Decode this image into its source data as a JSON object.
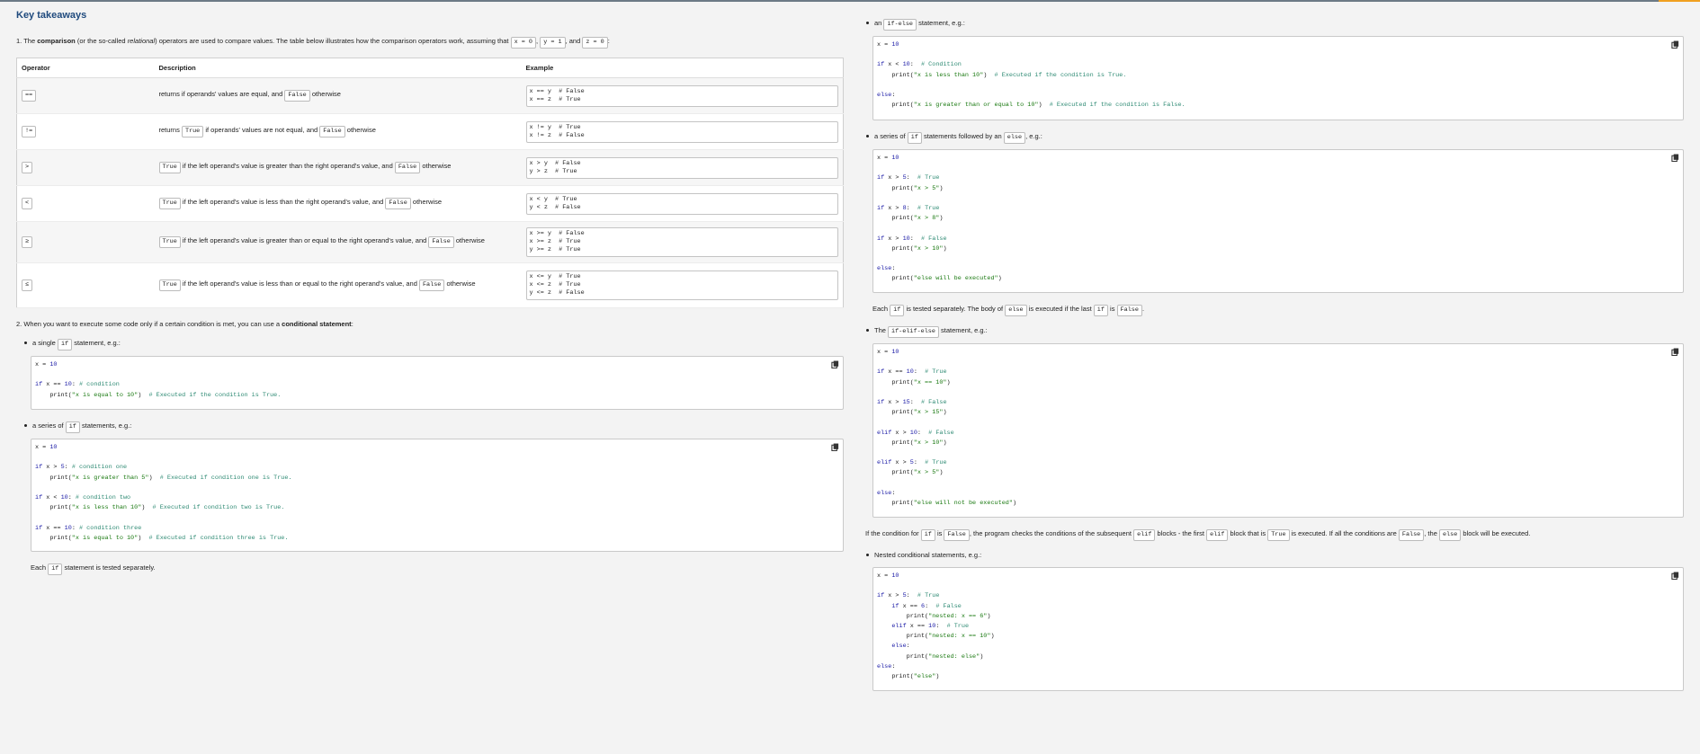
{
  "title": "Key takeaways",
  "intro": {
    "p1": "1. The ",
    "bold": "comparison",
    "p2": " (or the so-called ",
    "italic": "relational",
    "p3": ") operators are used to compare values. The table below illustrates how the comparison operators work, assuming that ",
    "c1": "x = 0",
    "sep1": ", ",
    "c2": "y = 1",
    "sep2": ", and ",
    "c3": "z = 0",
    "end": ":"
  },
  "table": {
    "headers": [
      "Operator",
      "Description",
      "Example"
    ],
    "rows": [
      {
        "op": "==",
        "desc_pre": "returns if operands' values are equal, and ",
        "desc_c1": "False",
        "desc_post": " otherwise",
        "example": [
          "x == y  # False",
          "x == z  # True"
        ]
      },
      {
        "op": "!=",
        "desc_pre": "returns ",
        "desc_c1": "True",
        "desc_mid": " if operands' values are not equal, and ",
        "desc_c2": "False",
        "desc_post": " otherwise",
        "example": [
          "x != y  # True",
          "x != z  # False"
        ]
      },
      {
        "op": ">",
        "desc_c1": "True",
        "desc_mid": " if the left operand's value is greater than the right operand's value, and ",
        "desc_c2": "False",
        "desc_post": " otherwise",
        "example": [
          "x > y  # False",
          "y > z  # True"
        ]
      },
      {
        "op": "<",
        "desc_c1": "True",
        "desc_mid": " if the left operand's value is less than the right operand's value, and ",
        "desc_c2": "False",
        "desc_post": " otherwise",
        "example": [
          "x < y  # True",
          "y < z  # False"
        ]
      },
      {
        "op": "≥",
        "desc_c1": "True",
        "desc_mid": " if the left operand's value is greater than or equal to the right operand's value, and ",
        "desc_c2": "False",
        "desc_post": " otherwise",
        "example": [
          "x >= y  # False",
          "x >= z  # True",
          "y >= z  # True"
        ]
      },
      {
        "op": "≤",
        "desc_c1": "True",
        "desc_mid": " if the left operand's value is less than or equal to the right operand's value, and ",
        "desc_c2": "False",
        "desc_post": " otherwise",
        "example": [
          "x <= y  # True",
          "x <= z  # True",
          "y <= z  # False"
        ]
      }
    ]
  },
  "section2": {
    "pre": "2. When you want to execute some code only if a certain condition is met, you can use a ",
    "bold": "conditional statement",
    "post": ":"
  },
  "b_single": {
    "pre": "a single ",
    "code": "if",
    "post": " statement, e.g.:"
  },
  "b_series": {
    "pre": "a series of ",
    "code": "if",
    "post": " statements, e.g.:"
  },
  "note_series": {
    "pre": "Each ",
    "code": "if",
    "post": " statement is tested separately."
  },
  "b_ifelse": {
    "pre": "an ",
    "code": "if-else",
    "post": " statement, e.g.:"
  },
  "b_series_else": {
    "pre": "a series of ",
    "code": "if",
    "mid": " statements followed by an ",
    "code2": "else",
    "post": ", e.g.:"
  },
  "note_series_else": {
    "pre": "Each ",
    "code1": "if",
    "mid1": " is tested separately. The body of ",
    "code2": "else",
    "mid2": " is executed if the last ",
    "code3": "if",
    "mid3": " is ",
    "code4": "False",
    "post": "."
  },
  "b_elif": {
    "pre": "The ",
    "code": "if-elif-else",
    "post": " statement, e.g.:"
  },
  "note_elif": {
    "t1": "If the condition for ",
    "c1": "if",
    "t2": " is ",
    "c2": "False",
    "t3": ", the program checks the conditions of the subsequent ",
    "c3": "elif",
    "t4": " blocks - the first ",
    "c4": "elif",
    "t5": " block that is ",
    "c5": "True",
    "t6": " is executed. If all the conditions are ",
    "c6": "False",
    "t7": ", the ",
    "c7": "else",
    "t8": " block will be executed."
  },
  "b_nested": {
    "label": "Nested conditional statements, e.g.:"
  },
  "code_icon": "copy-icon",
  "code": {
    "single": [
      "x = 10",
      "",
      "if x == 10: # condition",
      "    print(\"x is equal to 10\")  # Executed if the condition is True."
    ],
    "series": [
      "x = 10",
      "",
      "if x > 5: # condition one",
      "    print(\"x is greater than 5\")  # Executed if condition one is True.",
      "",
      "if x < 10: # condition two",
      "    print(\"x is less than 10\")  # Executed if condition two is True.",
      "",
      "if x == 10: # condition three",
      "    print(\"x is equal to 10\")  # Executed if condition three is True."
    ],
    "ifelse": [
      "x = 10",
      "",
      "if x < 10:  # Condition",
      "    print(\"x is less than 10\")  # Executed if the condition is True.",
      "",
      "else:",
      "    print(\"x is greater than or equal to 10\")  # Executed if the condition is False."
    ],
    "series_else": [
      "x = 10",
      "",
      "if x > 5:  # True",
      "    print(\"x > 5\")",
      "",
      "if x > 8:  # True",
      "    print(\"x > 8\")",
      "",
      "if x > 10:  # False",
      "    print(\"x > 10\")",
      "",
      "else:",
      "    print(\"else will be executed\")"
    ],
    "elif": [
      "x = 10",
      "",
      "if x == 10:  # True",
      "    print(\"x == 10\")",
      "",
      "if x > 15:  # False",
      "    print(\"x > 15\")",
      "",
      "elif x > 10:  # False",
      "    print(\"x > 10\")",
      "",
      "elif x > 5:  # True",
      "    print(\"x > 5\")",
      "",
      "else:",
      "    print(\"else will not be executed\")"
    ],
    "nested": [
      "x = 10",
      "",
      "if x > 5:  # True",
      "    if x == 6:  # False",
      "        print(\"nested: x == 6\")",
      "    elif x == 10:  # True",
      "        print(\"nested: x == 10\")",
      "    else:",
      "        print(\"nested: else\")",
      "else:",
      "    print(\"else\")"
    ]
  }
}
